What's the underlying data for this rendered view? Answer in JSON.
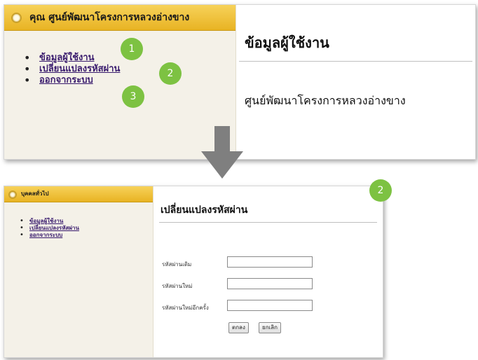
{
  "top_panel": {
    "sidebar_header": "คุณ ศูนย์พัฒนาโครงการหลวงอ่างขาง",
    "menu": [
      {
        "label": "ข้อมูลผู้ใช้งาน",
        "badge": "1"
      },
      {
        "label": "เปลี่ยนแปลงรหัสผ่าน",
        "badge": "2"
      },
      {
        "label": "ออกจากระบบ",
        "badge": "3"
      }
    ],
    "content_title": "ข้อมูลผู้ใช้งาน",
    "content_subtitle": "ศูนย์พัฒนาโครงการหลวงอ่างขาง"
  },
  "bottom_panel": {
    "sidebar_header": "บุคคลทั่วไป",
    "menu": [
      {
        "label": "ข้อมูลผู้ใช้งาน"
      },
      {
        "label": "เปลี่ยนแปลงรหัสผ่าน"
      },
      {
        "label": "ออกจากระบบ"
      }
    ],
    "content_title": "เปลี่ยนแปลงรหัสผ่าน",
    "badge": "2",
    "form": {
      "old_password_label": "รหัสผ่านเดิม",
      "new_password_label": "รหัสผ่านใหม่",
      "confirm_password_label": "รหัสผ่านใหม่อีกครั้ง",
      "ok_label": "ตกลง",
      "cancel_label": "ยกเลิก"
    }
  },
  "colors": {
    "header_gold": "#e8b323",
    "badge_green": "#7dc242",
    "arrow_gray": "#7f7f7f",
    "link_purple": "#3a1c6e"
  },
  "icons": {
    "flow_arrow": "arrow-down-icon",
    "header_marker": "radio-circle-icon"
  }
}
